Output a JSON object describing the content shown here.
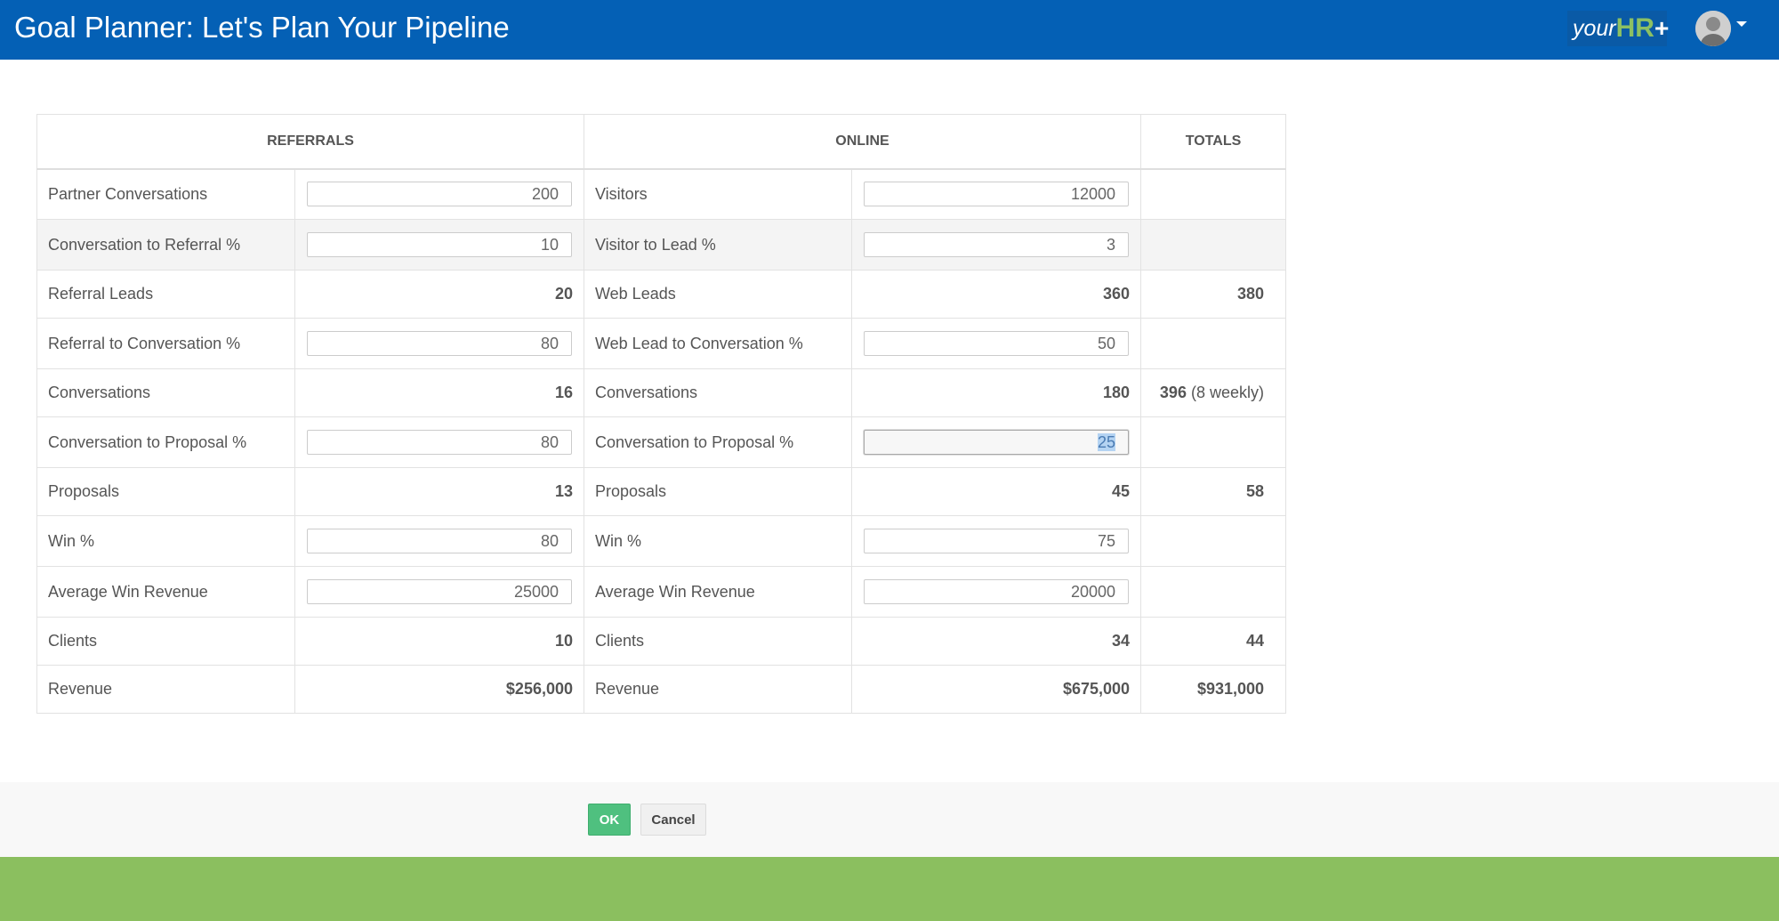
{
  "header": {
    "title": "Goal Planner: Let's Plan Your Pipeline",
    "brand": {
      "your": "your",
      "hr": "HR",
      "plus": "+"
    },
    "avatar_icon": "user-avatar"
  },
  "colors": {
    "topbar": "#0460b5",
    "ok_button": "#4fc07f",
    "bottom_band": "#8bbf5f",
    "selection": "#b4d3f2"
  },
  "planner": {
    "headers": {
      "referrals": "REFERRALS",
      "online": "ONLINE",
      "totals": "TOTALS"
    },
    "rows": [
      {
        "ref_label": "Partner Conversations",
        "ref_input": "200",
        "onl_label": "Visitors",
        "onl_input": "12000"
      },
      {
        "ref_label": "Conversation to Referral %",
        "ref_input": "10",
        "onl_label": "Visitor to Lead %",
        "onl_input": "3"
      },
      {
        "ref_label": "Referral Leads",
        "ref_value": "20",
        "onl_label": "Web Leads",
        "onl_value": "360",
        "total": "380"
      },
      {
        "ref_label": "Referral to Conversation %",
        "ref_input": "80",
        "onl_label": "Web Lead to Conversation %",
        "onl_input": "50"
      },
      {
        "ref_label": "Conversations",
        "ref_value": "16",
        "onl_label": "Conversations",
        "onl_value": "180",
        "total": "396",
        "total_weekly": "(8 weekly)"
      },
      {
        "ref_label": "Conversation to Proposal %",
        "ref_input": "80",
        "onl_label": "Conversation to Proposal %",
        "onl_input": "25"
      },
      {
        "ref_label": "Proposals",
        "ref_value": "13",
        "onl_label": "Proposals",
        "onl_value": "45",
        "total": "58"
      },
      {
        "ref_label": "Win %",
        "ref_input": "80",
        "onl_label": "Win %",
        "onl_input": "75"
      },
      {
        "ref_label": "Average Win Revenue",
        "ref_input": "25000",
        "onl_label": "Average Win Revenue",
        "onl_input": "20000"
      },
      {
        "ref_label": "Clients",
        "ref_value": "10",
        "onl_label": "Clients",
        "onl_value": "34",
        "total": "44"
      },
      {
        "ref_label": "Revenue",
        "ref_value": "$256,000",
        "onl_label": "Revenue",
        "onl_value": "$675,000",
        "total": "$931,000"
      }
    ]
  },
  "actions": {
    "ok": "OK",
    "cancel": "Cancel"
  }
}
